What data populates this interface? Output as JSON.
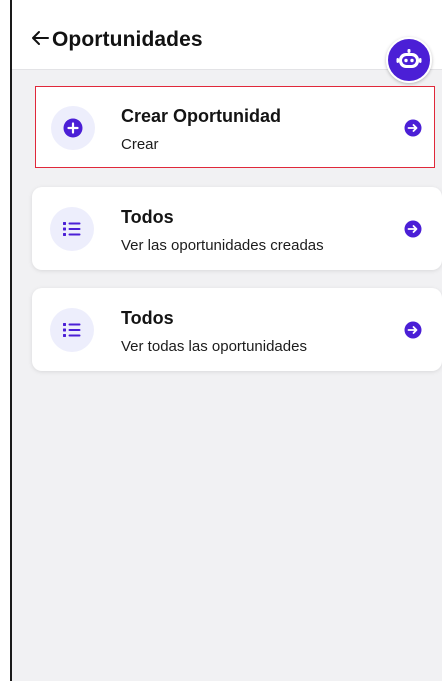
{
  "header": {
    "title": "Oportunidades",
    "back_icon": "arrow-left-icon",
    "assistant_icon": "robot-icon"
  },
  "cards": [
    {
      "title": "Crear Oportunidad",
      "subtitle": "Crear",
      "icon": "plus-circle-icon",
      "action_icon": "arrow-circle-right-icon",
      "selected": true
    },
    {
      "title": "Todos",
      "subtitle": "Ver las oportunidades creadas",
      "icon": "list-icon",
      "action_icon": "arrow-circle-right-icon"
    },
    {
      "title": "Todos",
      "subtitle": "Ver todas las oportunidades",
      "icon": "list-icon",
      "action_icon": "arrow-circle-right-icon"
    }
  ],
  "colors": {
    "accent": "#4b1fd6",
    "selection_outline": "#e0283a",
    "icon_bg": "#edeefc",
    "page_bg": "#f1f1f3"
  }
}
